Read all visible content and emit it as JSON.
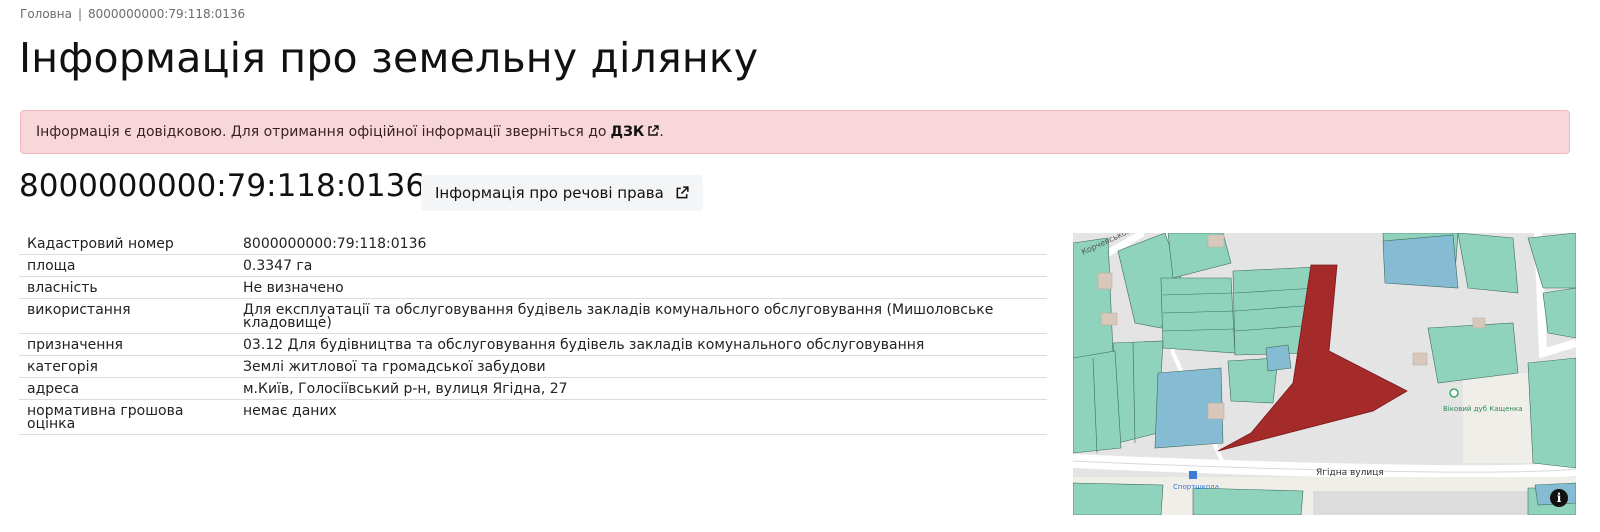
{
  "breadcrumb": {
    "home": "Головна",
    "separator": "|",
    "current": "8000000000:79:118:0136"
  },
  "page_title": "Інформація про земельну ділянку",
  "alert": {
    "text": "Інформація є довідковою. Для отримання офіційної інформації зверніться до",
    "link": "ДЗК",
    "suffix": ".",
    "link_icon": "external-link-icon",
    "bg_color": "#f8d7da"
  },
  "cadastral_title": "8000000000:79:118:0136",
  "rights_button": {
    "label": "Інформація про речові права",
    "icon": "external-link-icon"
  },
  "info_rows": [
    {
      "label": "Кадастровий номер",
      "value": "8000000000:79:118:0136"
    },
    {
      "label": "площа",
      "value": "0.3347 га"
    },
    {
      "label": "власність",
      "value": "Не визначено"
    },
    {
      "label": "використання",
      "value": "Для експлуатації та обслуговування будівель закладів комунального обслуговування (Мишоловське кладовище)"
    },
    {
      "label": "призначення",
      "value": "03.12 Для будівництва та обслуговування будівель закладів комунального обслуговування"
    },
    {
      "label": "категорія",
      "value": "Землі житлової та громадської забудови"
    },
    {
      "label": "адреса",
      "value": "м.Київ, Голосіївський р-н, вулиця Ягідна, 27"
    },
    {
      "label": "нормативна грошова оцінка",
      "value": "немає даних"
    }
  ],
  "map": {
    "street_label": "Ягідна вулиця",
    "street_label_top": "Корчевського",
    "poi_oak": "Віковий дуб Кащенка",
    "poi_school": "Спортшкола",
    "info_button": "i",
    "parcel_color": "#a52a2a",
    "parcel_green": "#8fd3bd",
    "parcel_blue": "#86bcd3"
  }
}
